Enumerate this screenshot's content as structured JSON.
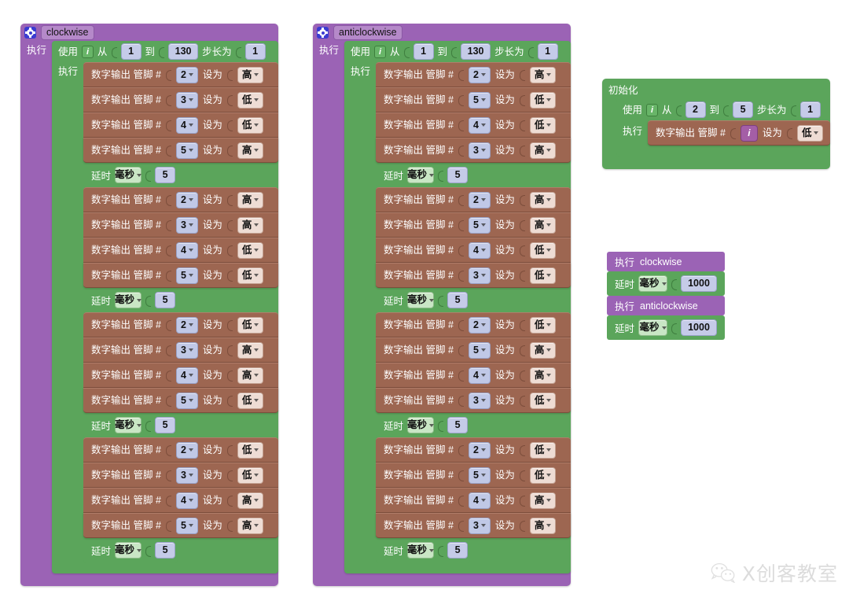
{
  "app": {
    "canvas_background": "#ffffff",
    "colors": {
      "procedure_purple": "#9b63b5",
      "control_green": "#5ba55b",
      "digital_write_brown": "#9d6651",
      "pin_field": "#c0c8e6",
      "state_field": "#eedcd4",
      "unit_field": "#c9e6c5",
      "gear_blue": "#3b3bd1"
    }
  },
  "labels": {
    "execute": "执行",
    "use": "使用",
    "from": "从",
    "to": "到",
    "step": "步长为",
    "digital_write": "数字输出 管脚 #",
    "set_to": "设为",
    "delay": "延时",
    "init": "初始化",
    "var_i": "i",
    "state_high": "高",
    "state_low": "低",
    "unit_ms": "毫秒"
  },
  "procedures": [
    {
      "name": "clockwise",
      "gear_icon": "gear-icon",
      "loop": {
        "var": "i",
        "from": "1",
        "to": "130",
        "step": "1"
      },
      "steps": [
        {
          "kind": "write",
          "pin": "2",
          "state": "高"
        },
        {
          "kind": "write",
          "pin": "3",
          "state": "低"
        },
        {
          "kind": "write",
          "pin": "4",
          "state": "低"
        },
        {
          "kind": "write",
          "pin": "5",
          "state": "高"
        },
        {
          "kind": "delay",
          "unit": "毫秒",
          "value": "5"
        },
        {
          "kind": "write",
          "pin": "2",
          "state": "高"
        },
        {
          "kind": "write",
          "pin": "3",
          "state": "高"
        },
        {
          "kind": "write",
          "pin": "4",
          "state": "低"
        },
        {
          "kind": "write",
          "pin": "5",
          "state": "低"
        },
        {
          "kind": "delay",
          "unit": "毫秒",
          "value": "5"
        },
        {
          "kind": "write",
          "pin": "2",
          "state": "低"
        },
        {
          "kind": "write",
          "pin": "3",
          "state": "高"
        },
        {
          "kind": "write",
          "pin": "4",
          "state": "高"
        },
        {
          "kind": "write",
          "pin": "5",
          "state": "低"
        },
        {
          "kind": "delay",
          "unit": "毫秒",
          "value": "5"
        },
        {
          "kind": "write",
          "pin": "2",
          "state": "低"
        },
        {
          "kind": "write",
          "pin": "3",
          "state": "低"
        },
        {
          "kind": "write",
          "pin": "4",
          "state": "高"
        },
        {
          "kind": "write",
          "pin": "5",
          "state": "高"
        },
        {
          "kind": "delay",
          "unit": "毫秒",
          "value": "5"
        }
      ]
    },
    {
      "name": "anticlockwise",
      "gear_icon": "gear-icon",
      "loop": {
        "var": "i",
        "from": "1",
        "to": "130",
        "step": "1"
      },
      "steps": [
        {
          "kind": "write",
          "pin": "2",
          "state": "高"
        },
        {
          "kind": "write",
          "pin": "5",
          "state": "低"
        },
        {
          "kind": "write",
          "pin": "4",
          "state": "低"
        },
        {
          "kind": "write",
          "pin": "3",
          "state": "高"
        },
        {
          "kind": "delay",
          "unit": "毫秒",
          "value": "5"
        },
        {
          "kind": "write",
          "pin": "2",
          "state": "高"
        },
        {
          "kind": "write",
          "pin": "5",
          "state": "高"
        },
        {
          "kind": "write",
          "pin": "4",
          "state": "低"
        },
        {
          "kind": "write",
          "pin": "3",
          "state": "低"
        },
        {
          "kind": "delay",
          "unit": "毫秒",
          "value": "5"
        },
        {
          "kind": "write",
          "pin": "2",
          "state": "低"
        },
        {
          "kind": "write",
          "pin": "5",
          "state": "高"
        },
        {
          "kind": "write",
          "pin": "4",
          "state": "高"
        },
        {
          "kind": "write",
          "pin": "3",
          "state": "低"
        },
        {
          "kind": "delay",
          "unit": "毫秒",
          "value": "5"
        },
        {
          "kind": "write",
          "pin": "2",
          "state": "低"
        },
        {
          "kind": "write",
          "pin": "5",
          "state": "低"
        },
        {
          "kind": "write",
          "pin": "4",
          "state": "高"
        },
        {
          "kind": "write",
          "pin": "3",
          "state": "高"
        },
        {
          "kind": "delay",
          "unit": "毫秒",
          "value": "5"
        }
      ]
    }
  ],
  "setup_block": {
    "title": "初始化",
    "loop": {
      "var": "i",
      "from": "2",
      "to": "5",
      "step": "1"
    },
    "body": {
      "kind": "write",
      "pin_var": "i",
      "state": "低"
    }
  },
  "main_sequence": [
    {
      "kind": "call",
      "label": "执行",
      "name": "clockwise"
    },
    {
      "kind": "delay",
      "label": "延时",
      "unit": "毫秒",
      "value": "1000"
    },
    {
      "kind": "call",
      "label": "执行",
      "name": "anticlockwise"
    },
    {
      "kind": "delay",
      "label": "延时",
      "unit": "毫秒",
      "value": "1000"
    }
  ],
  "watermark": {
    "icon": "wechat-icon",
    "text": "X创客教室"
  }
}
